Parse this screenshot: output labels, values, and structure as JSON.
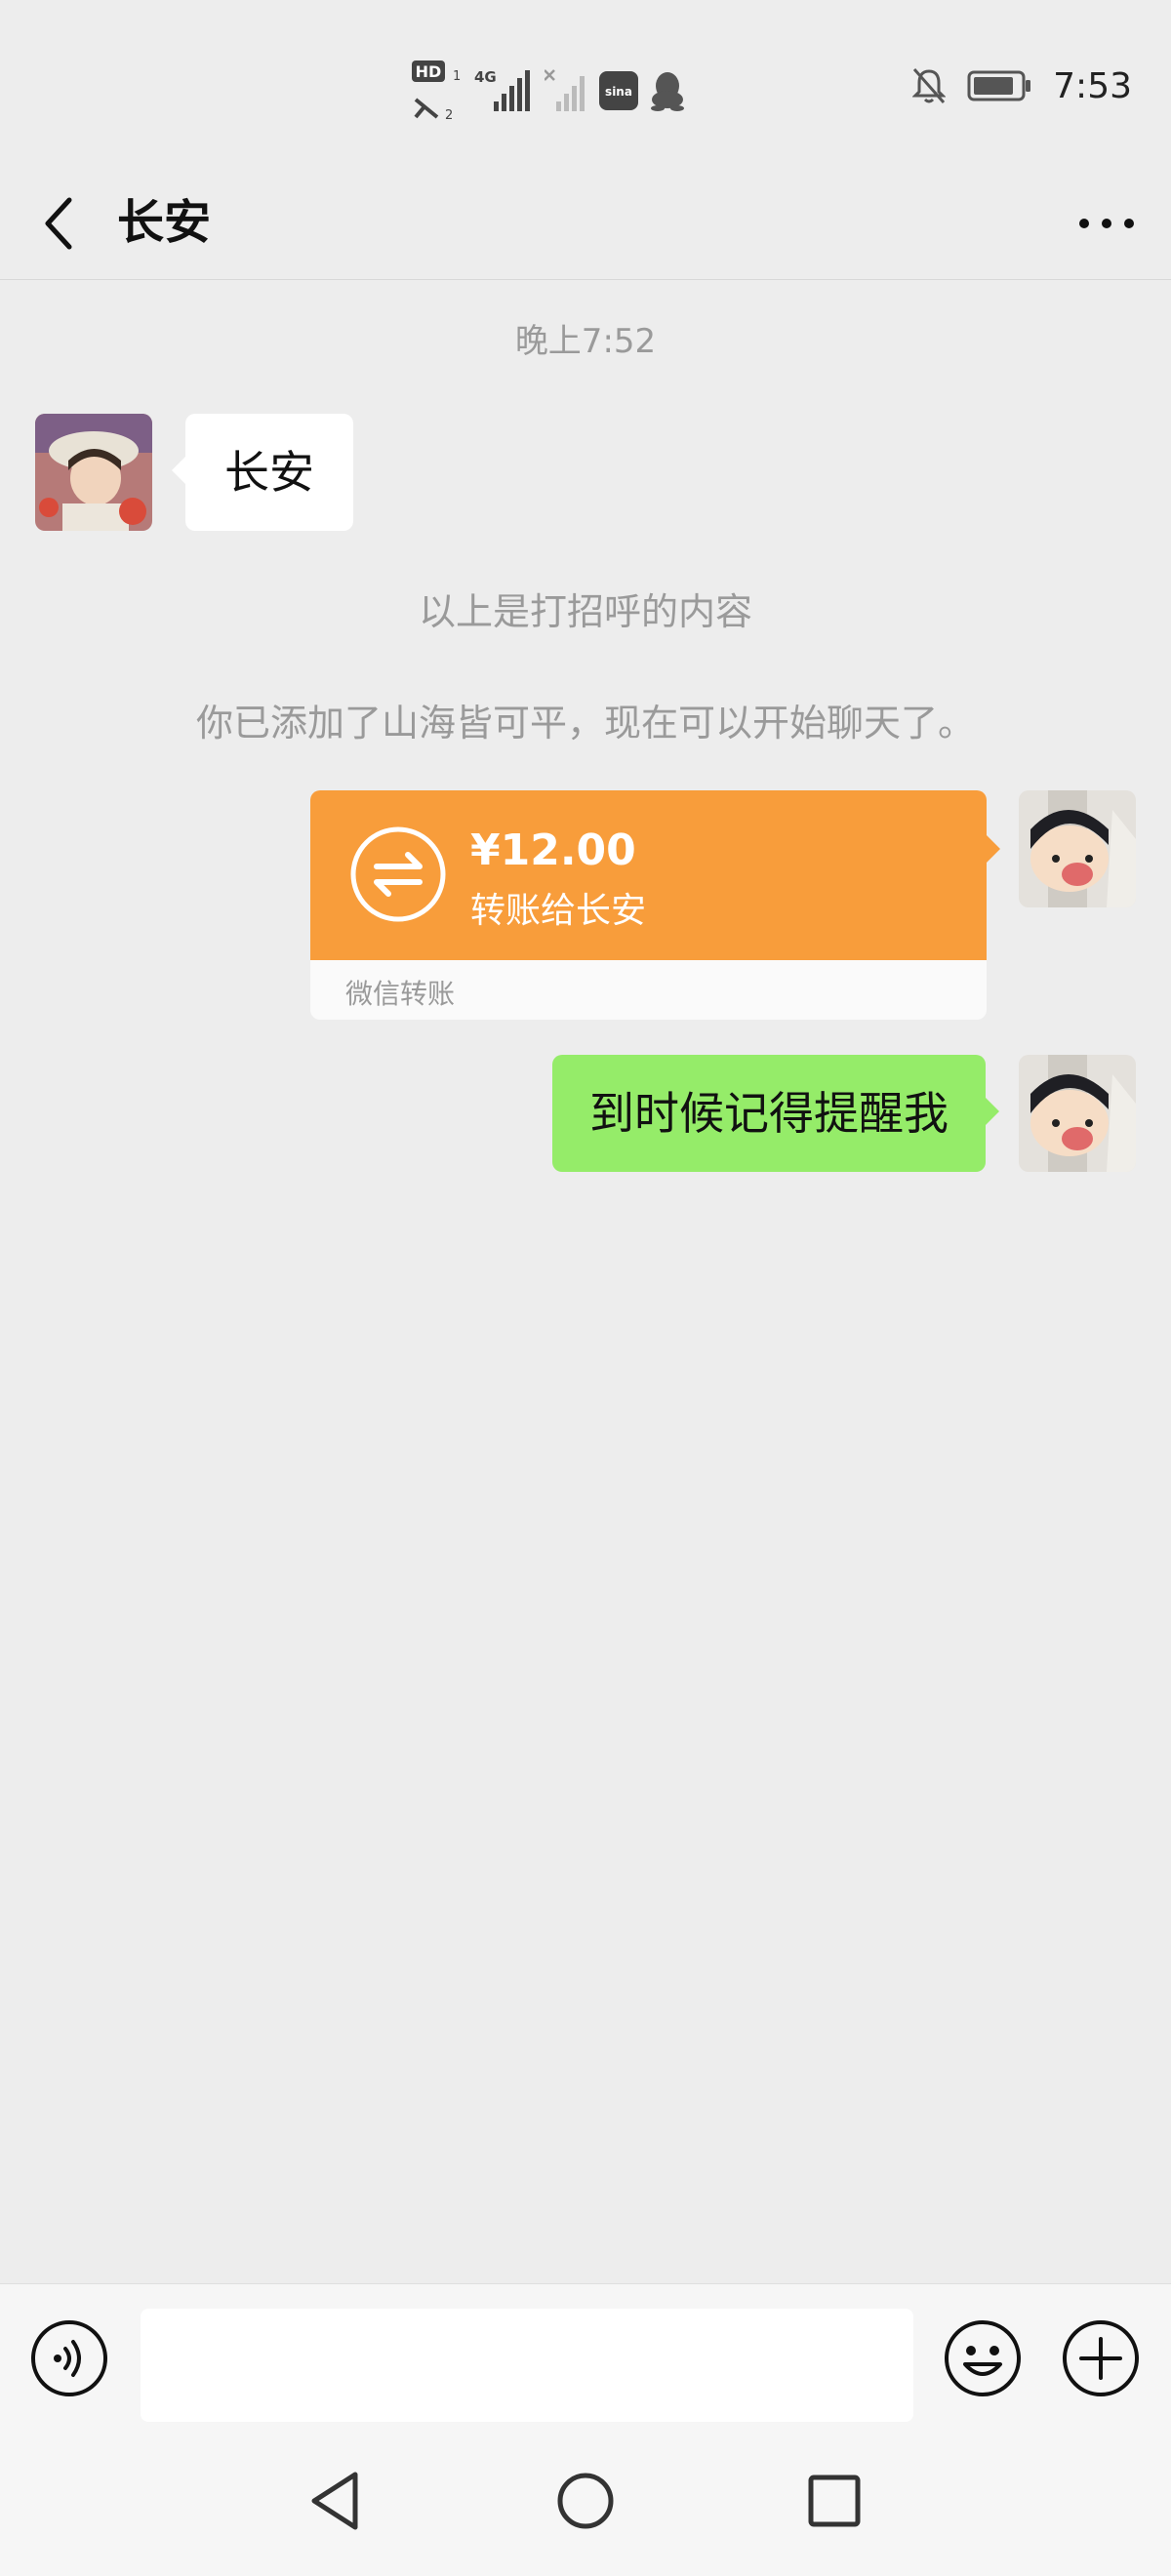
{
  "status_bar": {
    "time": "7:53",
    "icons": [
      "hd-call-icon",
      "signal-4g-icon",
      "signal-empty-icon",
      "sina-weibo-icon",
      "qq-icon",
      "mute-bell-icon",
      "battery-icon"
    ],
    "hd_label": "HD",
    "net_label": "4G",
    "sina_label": "sina"
  },
  "header": {
    "title": "长安",
    "back_icon": "chevron-left-icon",
    "more_icon": "more-dots-icon"
  },
  "chat": {
    "timestamp": "晚上7:52",
    "incoming_message": "长安",
    "system_greeting_note": "以上是打招呼的内容",
    "system_added_note": "你已添加了山海皆可平，现在可以开始聊天了。",
    "transfer": {
      "amount": "¥12.00",
      "description": "转账给长安",
      "footer": "微信转账",
      "color": "#f89d3b"
    },
    "outgoing_message": "到时候记得提醒我",
    "outgoing_color": "#95ec69"
  },
  "input_bar": {
    "text_value": "",
    "voice_icon": "voice-input-icon",
    "emoji_icon": "emoji-icon",
    "plus_icon": "plus-icon"
  },
  "nav_bar": {
    "icons": [
      "nav-back-icon",
      "nav-home-icon",
      "nav-recents-icon"
    ]
  }
}
